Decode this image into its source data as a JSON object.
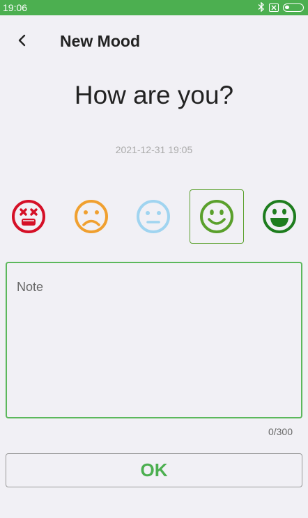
{
  "status_bar": {
    "time": "19:06",
    "bluetooth_icon": "bluetooth-icon",
    "sim_icon": "no-sim-icon",
    "battery_icon": "battery-icon"
  },
  "header": {
    "back_icon": "chevron-left-icon",
    "title": "New Mood"
  },
  "question": "How are you?",
  "timestamp": "2021-12-31 19:05",
  "moods": [
    {
      "name": "awful",
      "color": "#d51027",
      "icon": "dizzy-face-icon",
      "selected": false
    },
    {
      "name": "bad",
      "color": "#f0a030",
      "icon": "frowning-face-icon",
      "selected": false
    },
    {
      "name": "meh",
      "color": "#a0d4f0",
      "icon": "neutral-face-icon",
      "selected": false
    },
    {
      "name": "good",
      "color": "#5aa02c",
      "icon": "smiling-face-icon",
      "selected": true
    },
    {
      "name": "great",
      "color": "#1e7d1e",
      "icon": "grinning-face-icon",
      "selected": false
    }
  ],
  "note": {
    "placeholder": "Note",
    "value": "",
    "counter": "0/300"
  },
  "ok_label": "OK",
  "colors": {
    "accent": "#4caf50",
    "background": "#f1f0f5"
  }
}
